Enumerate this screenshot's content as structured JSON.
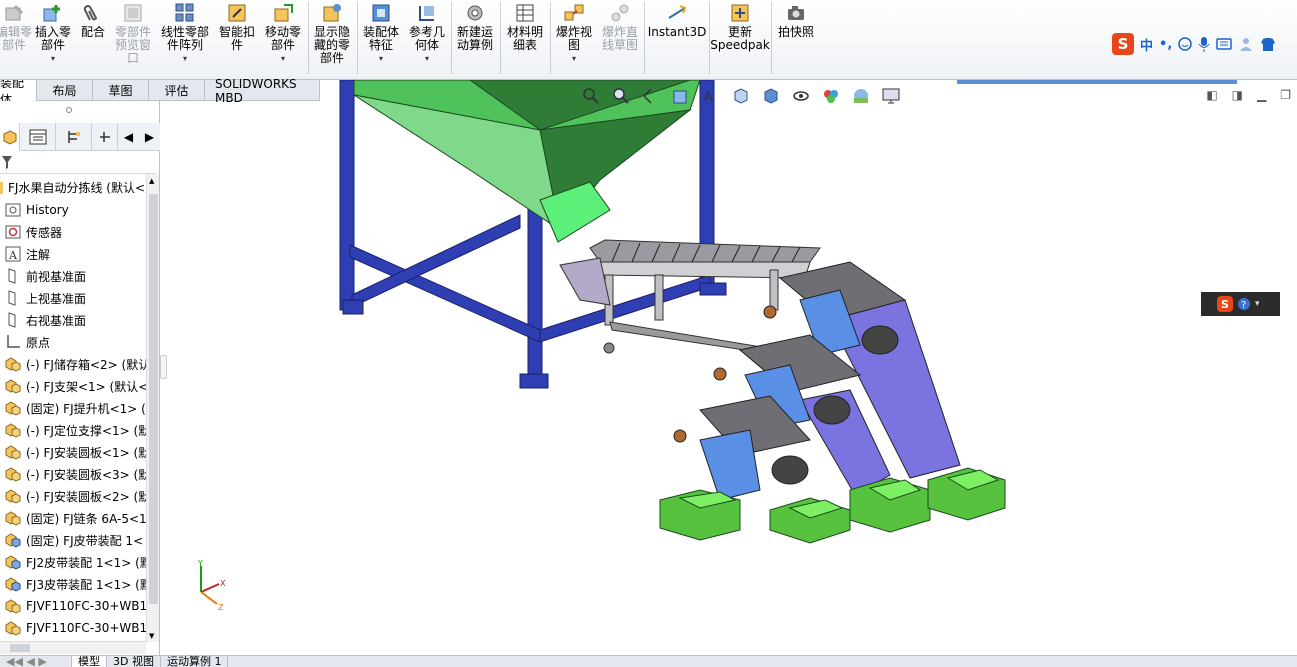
{
  "ribbon": {
    "buttons": [
      {
        "label": "编辑零\n部件",
        "disabled": true,
        "dropdown": false
      },
      {
        "label": "插入零\n部件",
        "disabled": false,
        "dropdown": true
      },
      {
        "label": "配合",
        "disabled": false,
        "dropdown": false
      },
      {
        "label": "零部件\n预览窗\n口",
        "disabled": true,
        "dropdown": false
      },
      {
        "label": "线性零部\n件阵列",
        "disabled": false,
        "dropdown": true
      },
      {
        "label": "智能扣\n件",
        "disabled": false,
        "dropdown": false
      },
      {
        "label": "移动零\n部件",
        "disabled": false,
        "dropdown": true
      },
      {
        "label": "显示隐\n藏的零\n部件",
        "disabled": false,
        "dropdown": false
      },
      {
        "label": "装配体\n特征",
        "disabled": false,
        "dropdown": true
      },
      {
        "label": "参考几\n何体",
        "disabled": false,
        "dropdown": true
      },
      {
        "label": "新建运\n动算例",
        "disabled": false,
        "dropdown": false
      },
      {
        "label": "材料明\n细表",
        "disabled": false,
        "dropdown": false
      },
      {
        "label": "爆炸视\n图",
        "disabled": false,
        "dropdown": true
      },
      {
        "label": "爆炸直\n线草图",
        "disabled": true,
        "dropdown": false
      },
      {
        "label": "Instant3D",
        "disabled": false,
        "dropdown": false
      },
      {
        "label": "更新\nSpeedpak",
        "disabled": false,
        "dropdown": false
      },
      {
        "label": "拍快照",
        "disabled": false,
        "dropdown": false
      }
    ]
  },
  "ime": {
    "logo": "S",
    "mode": "中",
    "punct": "•,"
  },
  "command_tabs": [
    "装配体",
    "布局",
    "草图",
    "评估",
    "SOLIDWORKS MBD"
  ],
  "tree": {
    "root": "FJ水果自动分拣线 (默认<",
    "items": [
      {
        "label": "History",
        "icon": "history-icon"
      },
      {
        "label": "传感器",
        "icon": "sensor-icon"
      },
      {
        "label": "注解",
        "icon": "annotation-icon"
      },
      {
        "label": "前视基准面",
        "icon": "plane-icon"
      },
      {
        "label": "上视基准面",
        "icon": "plane-icon"
      },
      {
        "label": "右视基准面",
        "icon": "plane-icon"
      },
      {
        "label": "原点",
        "icon": "origin-icon"
      },
      {
        "label": "(-) FJ储存箱<2> (默认",
        "icon": "assembly-icon"
      },
      {
        "label": "(-) FJ支架<1> (默认<",
        "icon": "assembly-icon"
      },
      {
        "label": "(固定) FJ提升机<1> (",
        "icon": "assembly-icon"
      },
      {
        "label": "(-) FJ定位支撑<1> (默",
        "icon": "assembly-icon"
      },
      {
        "label": "(-) FJ安装圆板<1> (默",
        "icon": "assembly-icon"
      },
      {
        "label": "(-) FJ安装圆板<3> (默",
        "icon": "assembly-icon"
      },
      {
        "label": "(-) FJ安装圆板<2> (默",
        "icon": "assembly-icon"
      },
      {
        "label": "(固定) FJ链条 6A-5<1",
        "icon": "assembly-icon"
      },
      {
        "label": "(固定) FJ皮带装配 1<",
        "icon": "subassembly-icon"
      },
      {
        "label": "FJ2皮带装配 1<1> (默",
        "icon": "subassembly-icon"
      },
      {
        "label": "FJ3皮带装配 1<1> (默",
        "icon": "subassembly-icon"
      },
      {
        "label": "FJVF110FC-30+WB1",
        "icon": "assembly-icon"
      },
      {
        "label": "FJVF110FC-30+WB1",
        "icon": "assembly-icon"
      }
    ]
  },
  "bottom_tabs": [
    "模型",
    "3D 视图",
    "运动算例 1"
  ],
  "colors": {
    "hopper_green": "#4fc25b",
    "frame_blue": "#2f3fb3",
    "chute_purple": "#7b74e0",
    "bin_green": "#56c23d"
  },
  "axes": {
    "x": "X",
    "y": "Y",
    "z": "Z"
  }
}
